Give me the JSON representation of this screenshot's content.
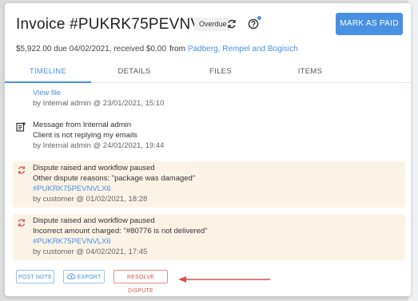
{
  "header": {
    "title": "Invoice #PUKRK75PEVNVLX6",
    "status_badge": "Overdue",
    "mark_paid_label": "MARK AS PAID",
    "summary": "$5,922.00 due 04/02/2021, received $0.00",
    "from_label": "from",
    "client_link": "Padberg, Rempel and Bogisich"
  },
  "tabs": [
    {
      "label": "TIMELINE",
      "active": true
    },
    {
      "label": "DETAILS",
      "active": false
    },
    {
      "label": "FILES",
      "active": false
    },
    {
      "label": "ITEMS",
      "active": false
    }
  ],
  "timeline": [
    {
      "type": "file",
      "link": "View file",
      "meta": "by Internal admin @ 23/01/2021, 15:10"
    },
    {
      "type": "message",
      "icon": "note-icon",
      "title": "Message from Internal admin",
      "body": "Client is not replying my emails",
      "meta": "by Internal admin @ 24/01/2021, 19:44"
    },
    {
      "type": "dispute",
      "icon": "dispute-sync-icon",
      "title": "Dispute raised and workflow paused",
      "body": "Other dispute reasons: \"package was damaged\"",
      "link": "#PUKRK75PEVNVLX6",
      "meta": "by customer @ 01/02/2021, 18:28"
    },
    {
      "type": "dispute",
      "icon": "dispute-sync-icon",
      "title": "Dispute raised and workflow paused",
      "body": "Incorrect amount charged: \"#80776 is not delivered\"",
      "link": "#PUKRK75PEVNVLX6",
      "meta": "by customer @ 04/02/2021, 17:45"
    }
  ],
  "actions": {
    "post_note": "POST NOTE",
    "export": "EXPORT",
    "resolve_dispute": "RESOLVE DISPUTE"
  },
  "colors": {
    "accent": "#4a90e2",
    "danger": "#d9534f",
    "dispute_bg": "#fcf3e7"
  }
}
